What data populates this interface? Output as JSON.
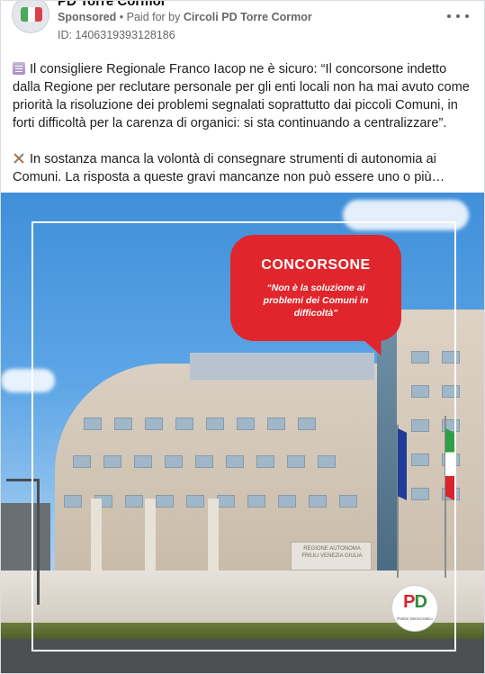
{
  "header": {
    "page_name": "PD Torre Cormor",
    "sponsored_label": "Sponsored",
    "separator": " • ",
    "paid_for_prefix": "Paid for by ",
    "payer": "Circoli PD Torre Cormor",
    "ad_id": "ID: 1406319393128186"
  },
  "post": {
    "paragraph_1": "Il consigliere Regionale Franco Iacop ne è sicuro: “Il concorsone indetto dalla Regione per reclutare personale per gli enti locali non ha mai avuto come priorità la risoluzione dei problemi segnalati soprattutto dai piccoli Comuni, in forti difficoltà per la carenza di organici: si sta continuando a centralizzare”.",
    "paragraph_2": "In sostanza manca la volontà di consegnare strumenti di autonomia ai Comuni. La risposta a queste gravi mancanze non può essere uno o più…",
    "icon_1": "memo-emoji-icon",
    "icon_2": "hammer-and-pick-emoji-icon"
  },
  "image": {
    "bubble_title": "CONCORSONE",
    "bubble_subtitle": "“Non è la soluzione ai problemi dei Comuni in difficoltà”",
    "building_sign": "REGIONE AUTONOMA FRIULI VENEZIA GIULIA",
    "logo_text_p": "P",
    "logo_text_d": "D",
    "logo_caption": "Partito Democratico"
  },
  "colors": {
    "accent_red": "#e0252c",
    "secondary_text": "#65676b",
    "pd_green": "#2e8b3d"
  }
}
